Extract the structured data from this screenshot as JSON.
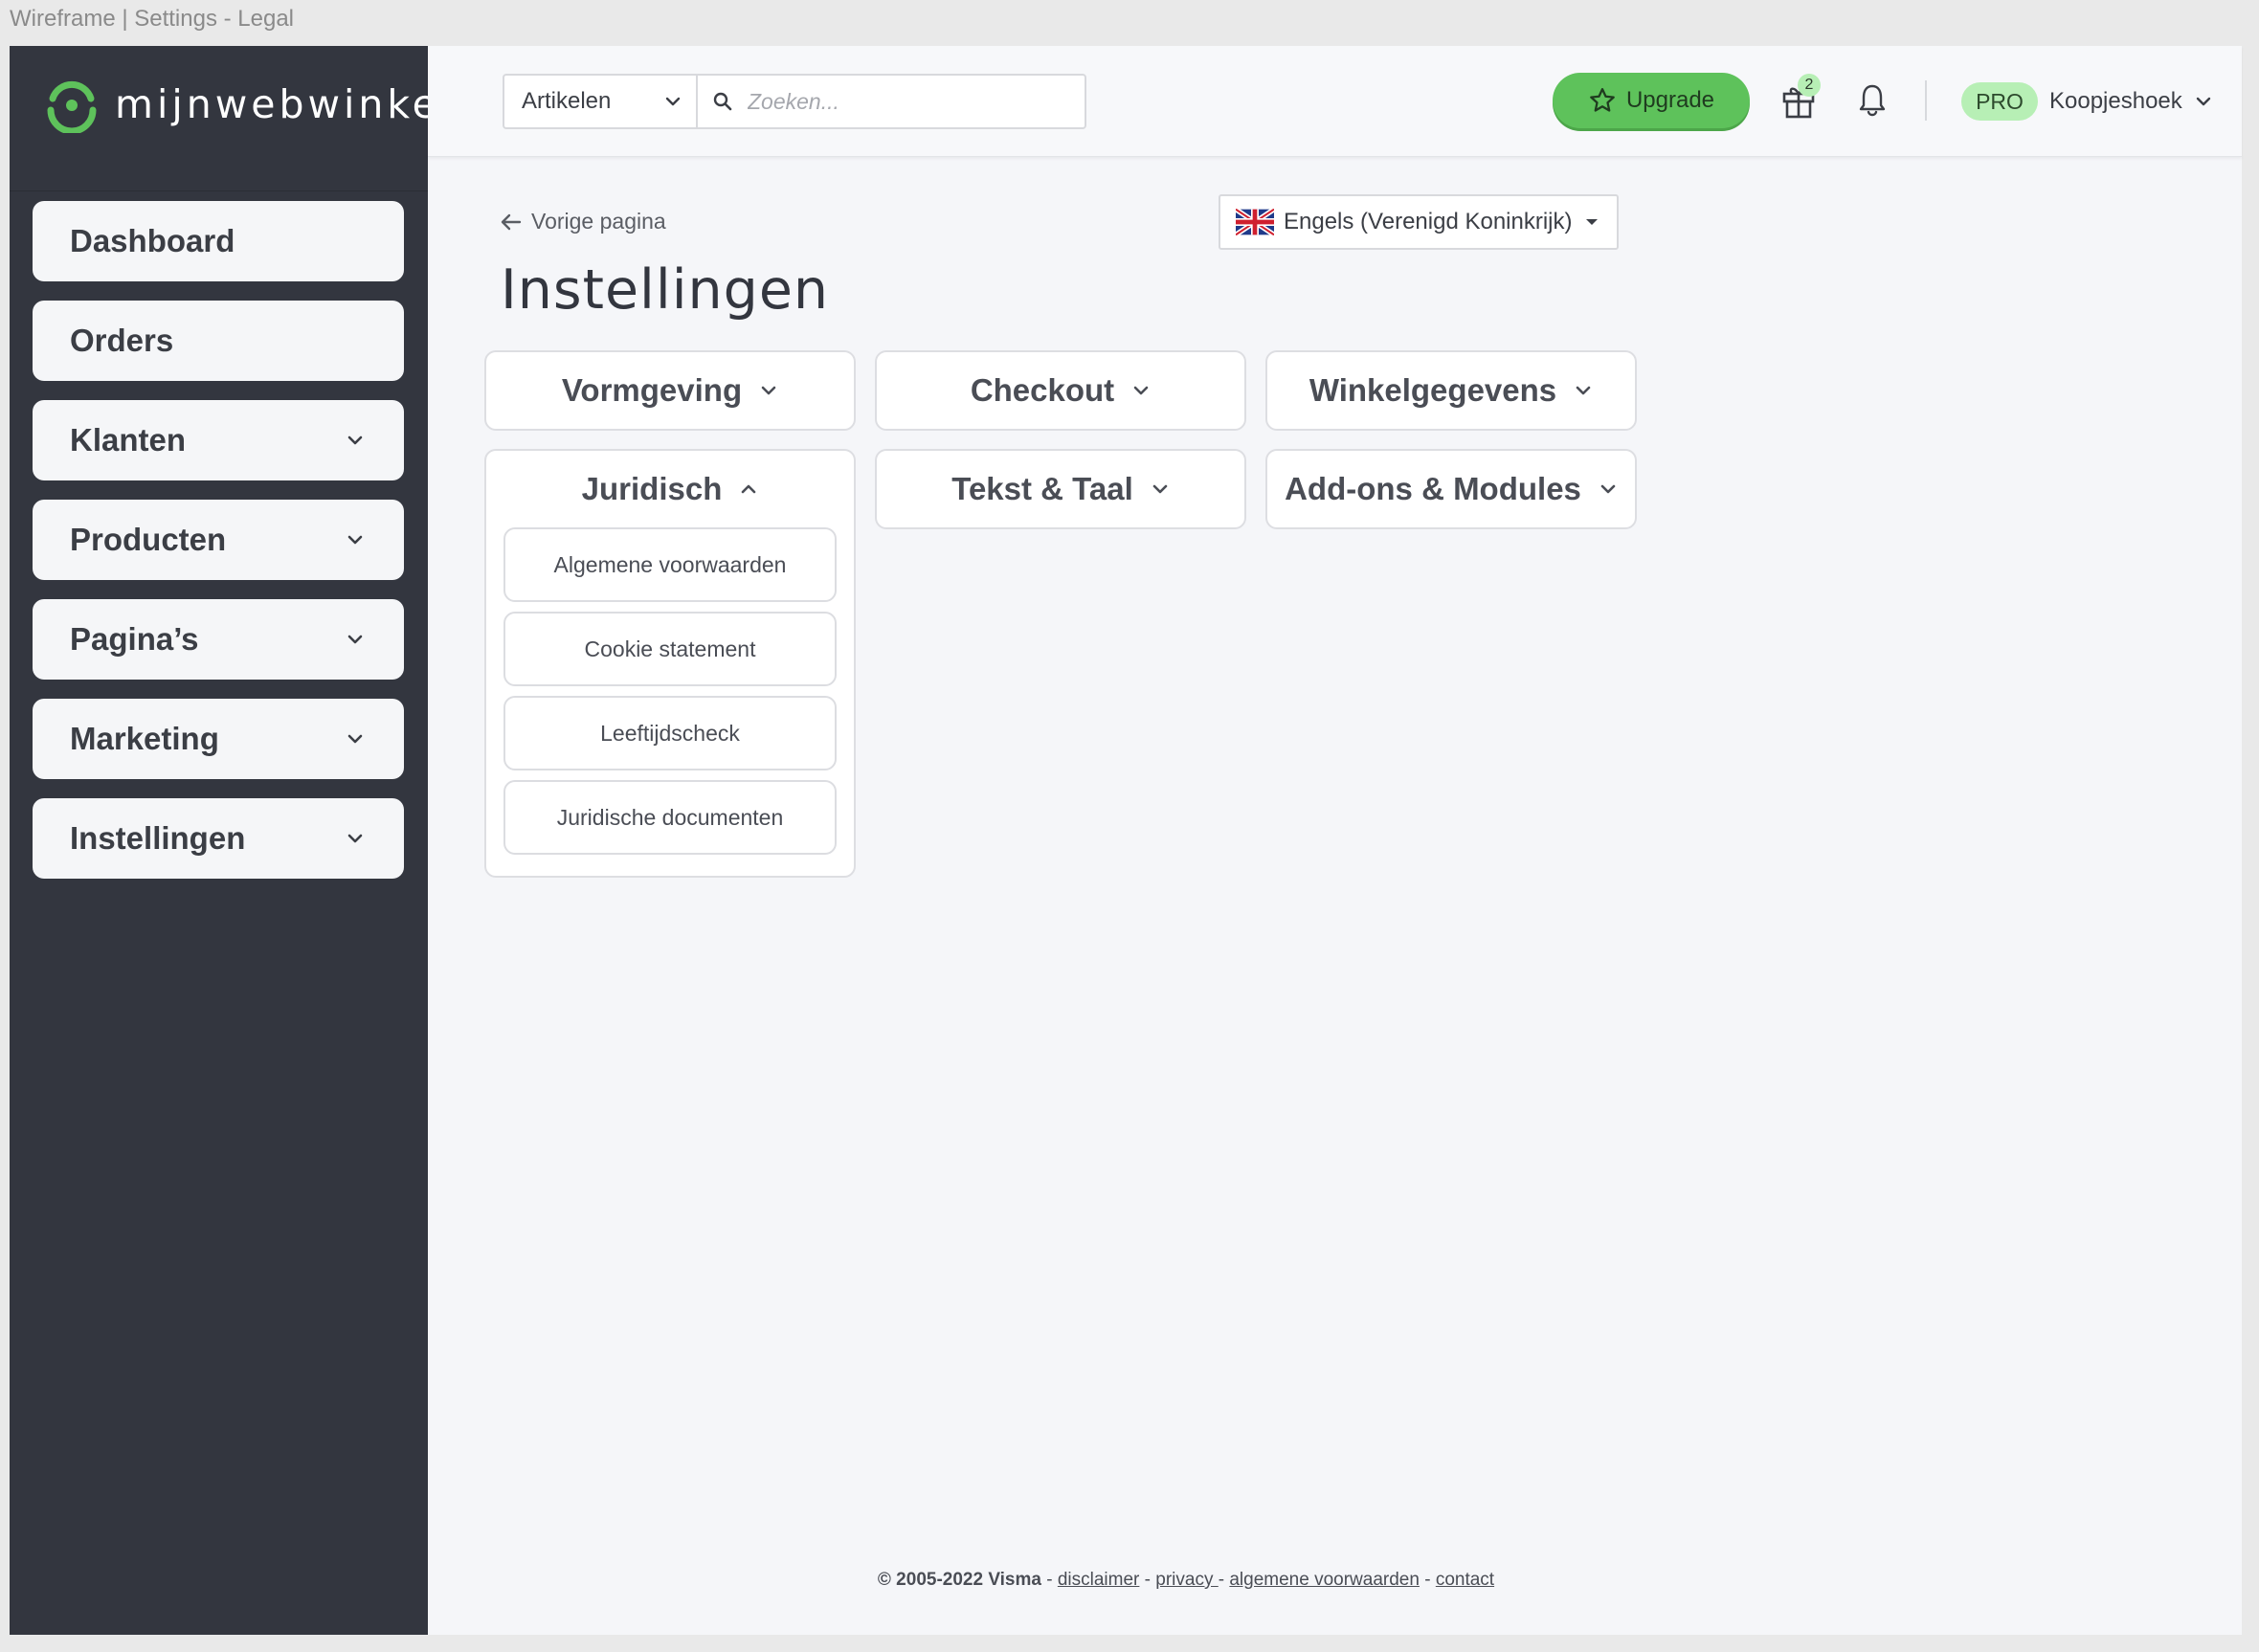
{
  "window": {
    "title": "Wireframe | Settings - Legal"
  },
  "brand": {
    "name": "mijnwebwinkel",
    "accent": "#5ec25b",
    "sidebar_bg": "#33363f"
  },
  "sidebar": {
    "items": [
      {
        "label": "Dashboard",
        "expandable": false
      },
      {
        "label": "Orders",
        "expandable": false
      },
      {
        "label": "Klanten",
        "expandable": true
      },
      {
        "label": "Producten",
        "expandable": true
      },
      {
        "label": "Pagina’s",
        "expandable": true
      },
      {
        "label": "Marketing",
        "expandable": true
      },
      {
        "label": "Instellingen",
        "expandable": true
      }
    ]
  },
  "topbar": {
    "search_scope": "Artikelen",
    "search_placeholder": "Zoeken...",
    "upgrade_label": "Upgrade",
    "gift_count": "2",
    "plan_badge": "PRO",
    "account_name": "Koopjeshoek"
  },
  "page": {
    "back_label": "Vorige pagina",
    "title": "Instellingen",
    "language": "Engels (Verenigd Koninkrijk)"
  },
  "categories": [
    {
      "label": "Vormgeving",
      "expanded": false
    },
    {
      "label": "Checkout",
      "expanded": false
    },
    {
      "label": "Winkelgegevens",
      "expanded": false
    },
    {
      "label": "Juridisch",
      "expanded": true,
      "items": [
        "Algemene voorwaarden",
        "Cookie statement",
        "Leeftijdscheck",
        "Juridische documenten"
      ]
    },
    {
      "label": "Tekst & Taal",
      "expanded": false
    },
    {
      "label": "Add-ons & Modules",
      "expanded": false
    }
  ],
  "footer": {
    "copyright": "© 2005-2022 Visma",
    "sep": " - ",
    "links": [
      "disclaimer",
      "privacy ",
      "algemene voorwaarden",
      "contact"
    ]
  }
}
